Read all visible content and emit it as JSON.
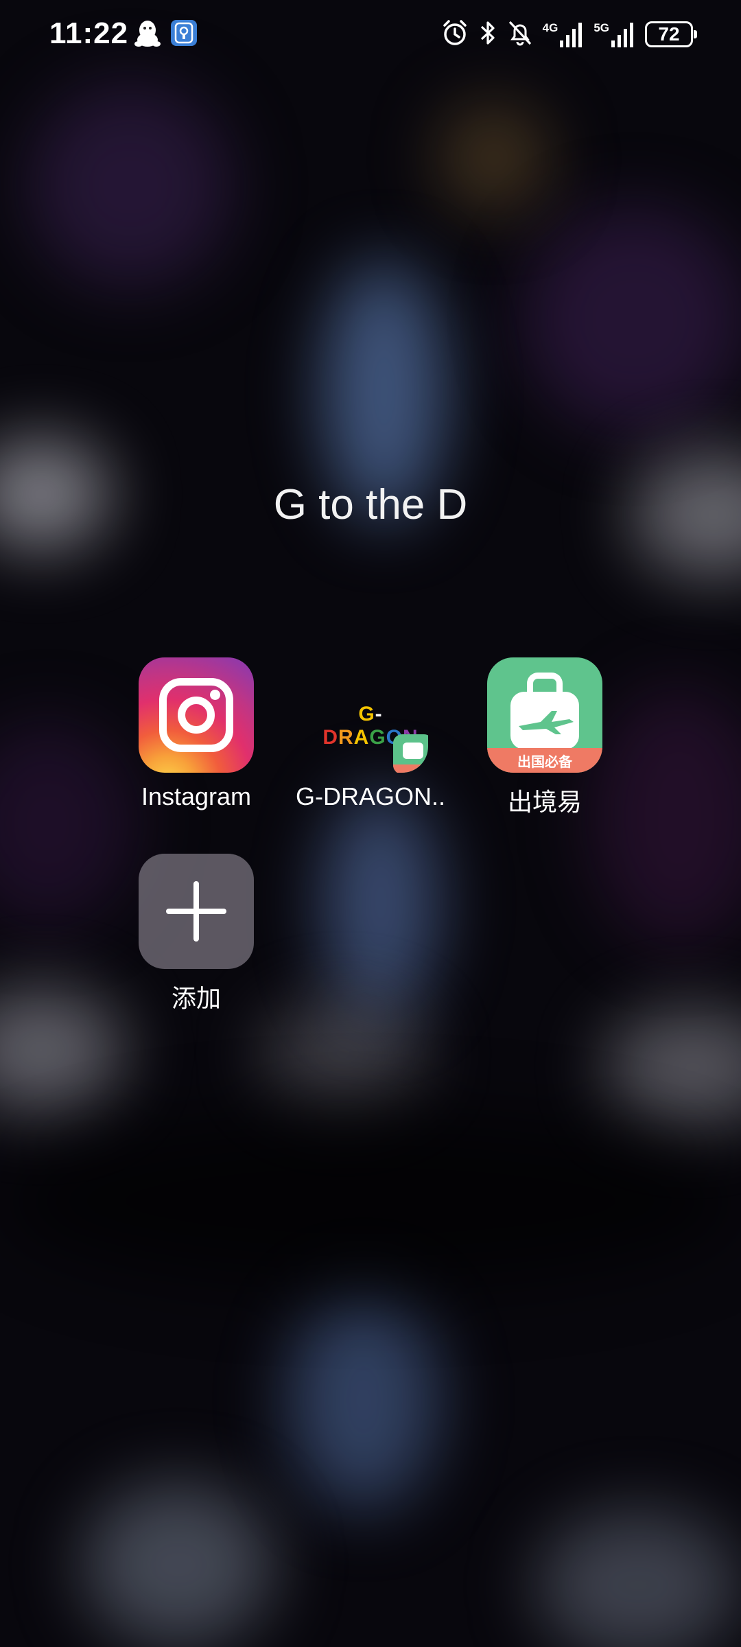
{
  "status_bar": {
    "time": "11:22",
    "left_icons": [
      "qq-penguin-icon",
      "bluetooth-keeper-app-icon"
    ],
    "right_icons": [
      "alarm-icon",
      "bluetooth-icon",
      "silent-bell-icon"
    ],
    "network_1": "4G",
    "network_2": "5G",
    "battery_level": "72"
  },
  "folder": {
    "title": "G to the D"
  },
  "apps": [
    {
      "label": "Instagram",
      "icon": "instagram-icon"
    },
    {
      "label": "G-DRAGON..",
      "icon": "g-dragon-folder-icon",
      "logo_text": "G-DRAGON",
      "logo_colors": [
        "#f5c400",
        "#ffffff",
        "#e2342b",
        "#f39a1d",
        "#f5c400",
        "#3aa047",
        "#2a76c8",
        "#8b3da8"
      ]
    },
    {
      "label": "出境易",
      "icon": "travel-suitcase-icon",
      "badge": "出国必备"
    },
    {
      "label": "添加",
      "icon": "add-icon"
    }
  ],
  "colors": {
    "instagram_gradient": [
      "#fdd74a",
      "#e1306c",
      "#833ab4"
    ],
    "travel_green": "#5fc48d",
    "travel_orange": "#ef7a64"
  }
}
